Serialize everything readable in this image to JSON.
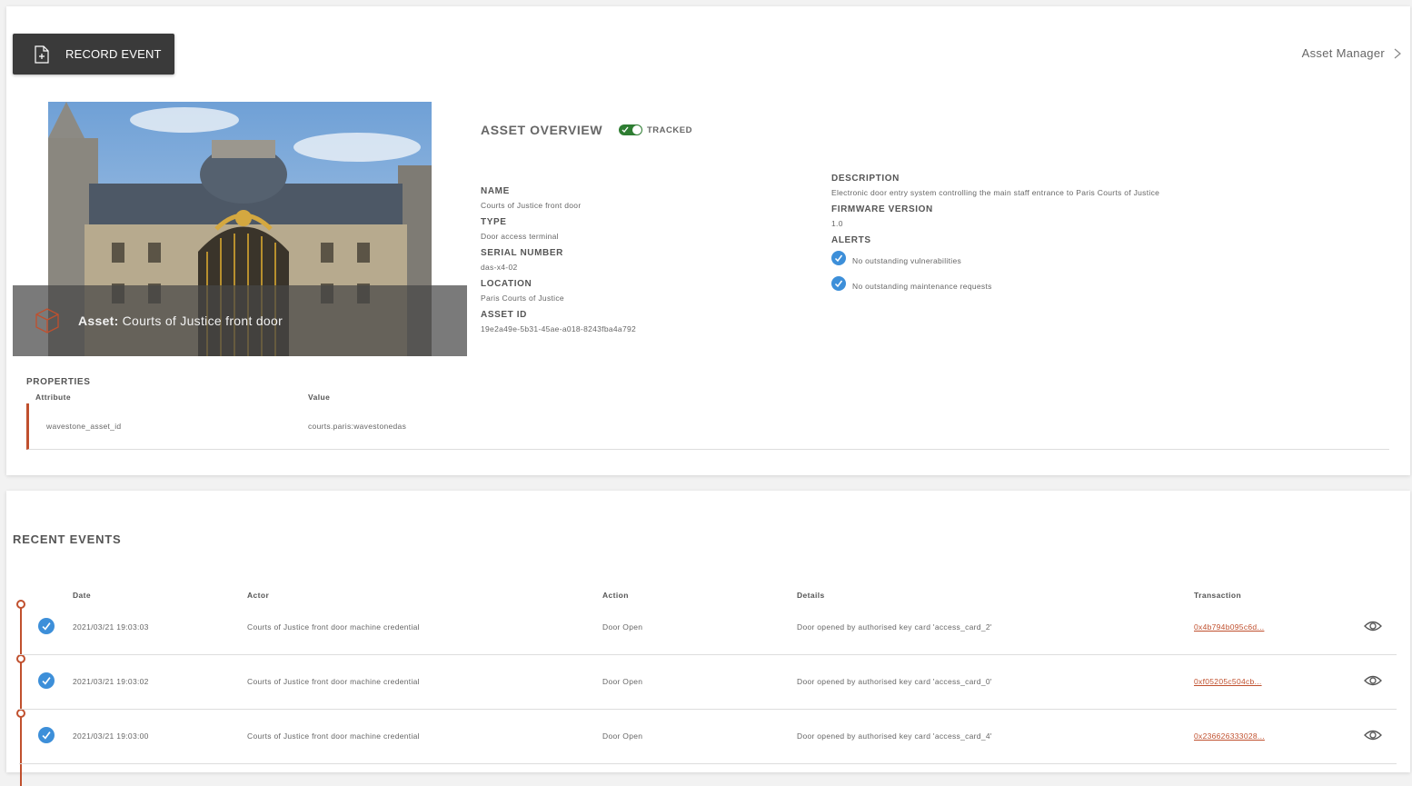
{
  "toolbar": {
    "record_label": "RECORD EVENT"
  },
  "nav": {
    "asset_manager": "Asset Manager"
  },
  "hero": {
    "caption_prefix": "Asset:",
    "caption_name": "Courts of Justice front door"
  },
  "overview": {
    "title": "ASSET OVERVIEW",
    "status": "TRACKED",
    "fields_left": [
      {
        "label": "NAME",
        "value": "Courts of Justice front door"
      },
      {
        "label": "TYPE",
        "value": "Door access terminal"
      },
      {
        "label": "SERIAL NUMBER",
        "value": "das-x4-02"
      },
      {
        "label": "LOCATION",
        "value": "Paris Courts of Justice"
      },
      {
        "label": "ASSET ID",
        "value": "19e2a49e-5b31-45ae-a018-8243fba4a792"
      }
    ],
    "fields_right": [
      {
        "label": "DESCRIPTION",
        "value": "Electronic door entry system controlling the main staff entrance to Paris Courts of Justice"
      },
      {
        "label": "FIRMWARE VERSION",
        "value": "1.0"
      }
    ],
    "alerts_label": "ALERTS",
    "alerts": [
      "No outstanding vulnerabilities",
      "No outstanding maintenance requests"
    ]
  },
  "properties": {
    "title": "PROPERTIES",
    "col_attribute": "Attribute",
    "col_value": "Value",
    "rows": [
      {
        "attribute": "wavestone_asset_id",
        "value": "courts.paris:wavestonedas"
      }
    ]
  },
  "events": {
    "title": "RECENT EVENTS",
    "columns": {
      "date": "Date",
      "actor": "Actor",
      "action": "Action",
      "details": "Details",
      "transaction": "Transaction"
    },
    "rows": [
      {
        "date": "2021/03/21 19:03:03",
        "actor": "Courts of Justice front door machine credential",
        "action": "Door Open",
        "details": "Door opened by authorised key card 'access_card_2'",
        "transaction": "0x4b794b095c6d..."
      },
      {
        "date": "2021/03/21 19:03:02",
        "actor": "Courts of Justice front door machine credential",
        "action": "Door Open",
        "details": "Door opened by authorised key card 'access_card_0'",
        "transaction": "0xf05205c504cb..."
      },
      {
        "date": "2021/03/21 19:03:00",
        "actor": "Courts of Justice front door machine credential",
        "action": "Door Open",
        "details": "Door opened by authorised key card 'access_card_4'",
        "transaction": "0x236626333028..."
      }
    ]
  },
  "colors": {
    "accent": "#c0502e",
    "check_blue": "#3d8fd9",
    "toggle_green": "#2e7d32",
    "button_dark": "#3a3a3a"
  },
  "icons": [
    "file-plus-icon",
    "chevron-right-icon",
    "cube-icon",
    "check-circle-icon",
    "eye-icon"
  ]
}
